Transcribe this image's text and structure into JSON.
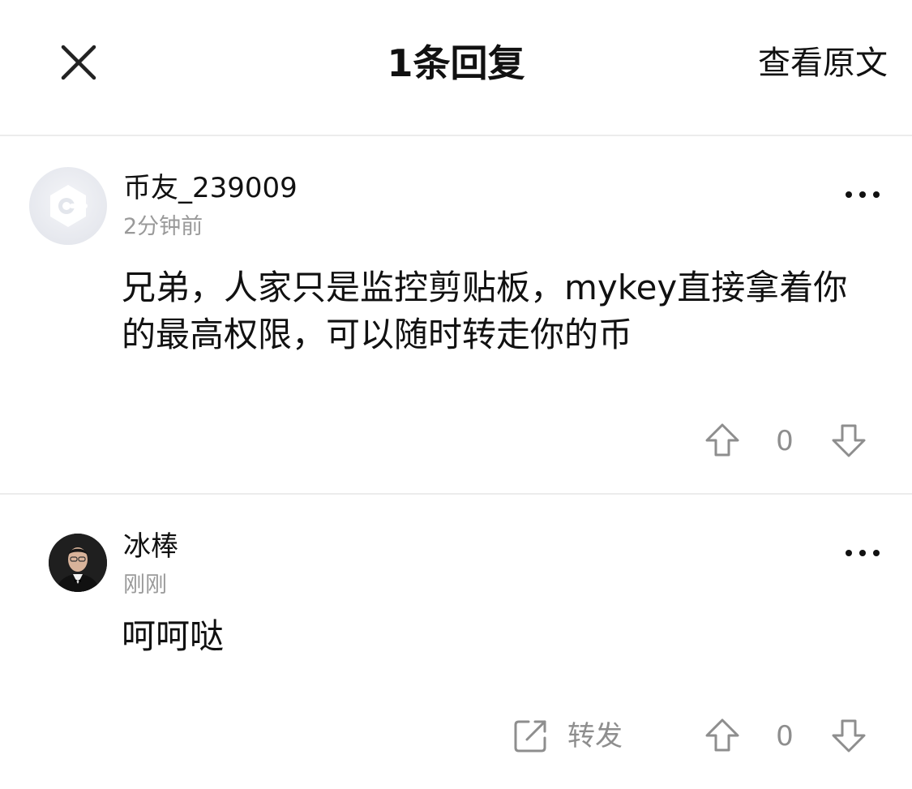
{
  "header": {
    "title": "1条回复",
    "view_original_label": "查看原文"
  },
  "main_comment": {
    "username": "币友_239009",
    "timestamp": "2分钟前",
    "content": "兄弟，人家只是监控剪贴板，mykey直接拿着你的最高权限，可以随时转走你的币",
    "vote_count": "0"
  },
  "reply": {
    "username": "冰棒",
    "timestamp": "刚刚",
    "content": "呵呵哒",
    "share_label": "转发",
    "vote_count": "0"
  },
  "colors": {
    "text": "#111111",
    "secondary_text": "#9a9a9a",
    "icon_gray": "#8e8e8e",
    "divider": "#ececec"
  }
}
